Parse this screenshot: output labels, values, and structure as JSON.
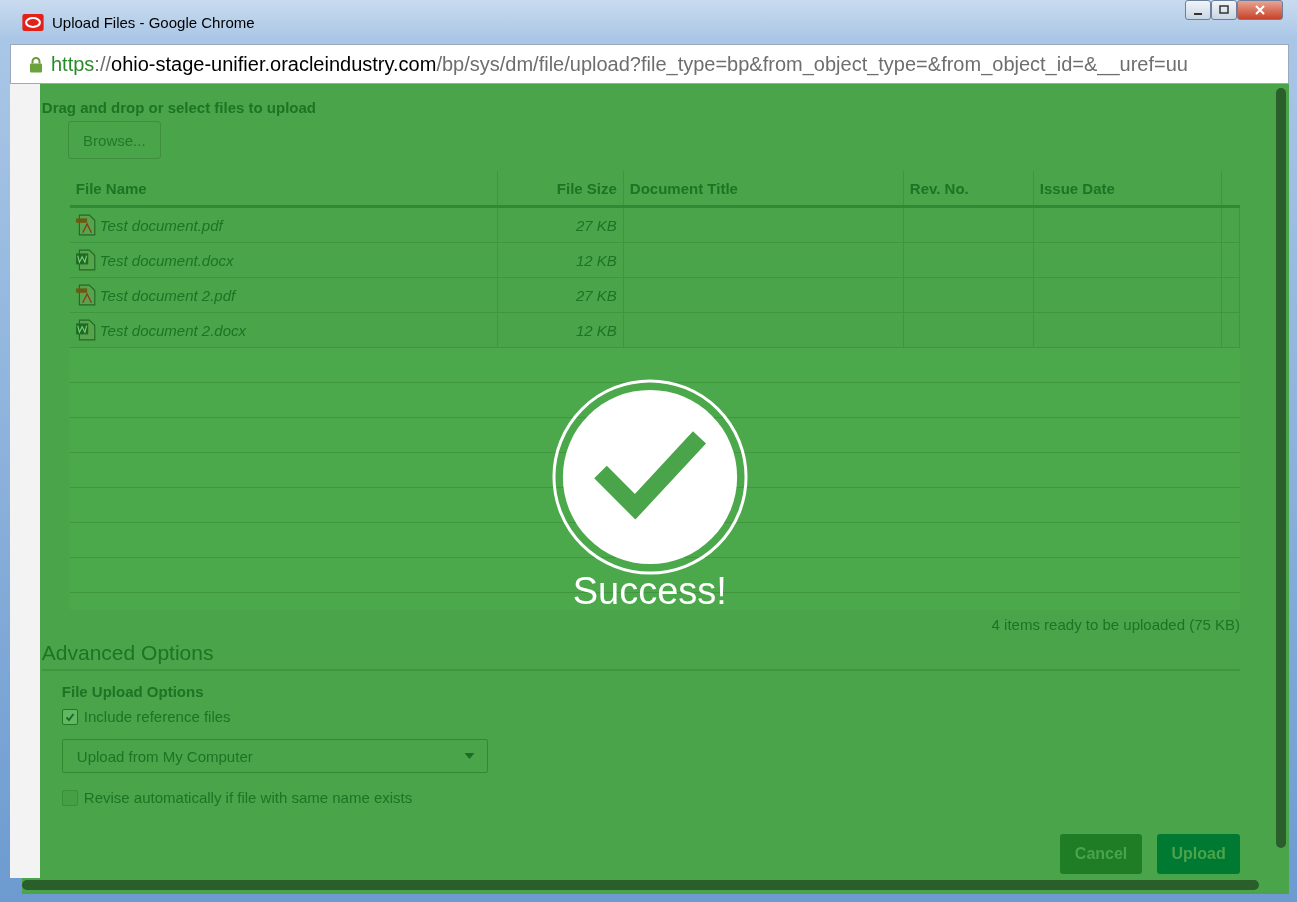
{
  "window": {
    "title": "Upload Files - Google Chrome"
  },
  "address_bar": {
    "scheme": "https",
    "separator": "://",
    "host": "ohio-stage-unifier.oracleindustry.com",
    "path": "/bp/sys/dm/file/upload?file_type=bp&from_object_type=&from_object_id=&__uref=uu"
  },
  "upload": {
    "instruction": "Drag and drop or select files to upload",
    "browse_button": "Browse..."
  },
  "table": {
    "columns": [
      "File Name",
      "File Size",
      "Document Title",
      "Rev. No.",
      "Issue Date"
    ],
    "rows": [
      {
        "kind": "pdf",
        "name": "Test document.pdf",
        "size": "27 KB"
      },
      {
        "kind": "word",
        "name": "Test document.docx",
        "size": "12 KB"
      },
      {
        "kind": "pdf",
        "name": "Test document 2.pdf",
        "size": "27 KB"
      },
      {
        "kind": "word",
        "name": "Test document 2.docx",
        "size": "12 KB"
      }
    ],
    "summary": "4 items ready to be uploaded (75 KB)"
  },
  "advanced": {
    "title": "Advanced Options",
    "subtitle": "File Upload Options",
    "options": [
      {
        "label": "Include reference files",
        "checked": true
      }
    ],
    "source": {
      "value": "Upload from My Computer"
    },
    "revise": {
      "label": "Revise automatically if file with same name exists",
      "checked": false,
      "disabled": true
    }
  },
  "buttons": [
    {
      "kind": "secondary",
      "label": "Cancel"
    },
    {
      "kind": "primary",
      "label": "Upload"
    }
  ],
  "overlay": {
    "message": "Success!"
  }
}
